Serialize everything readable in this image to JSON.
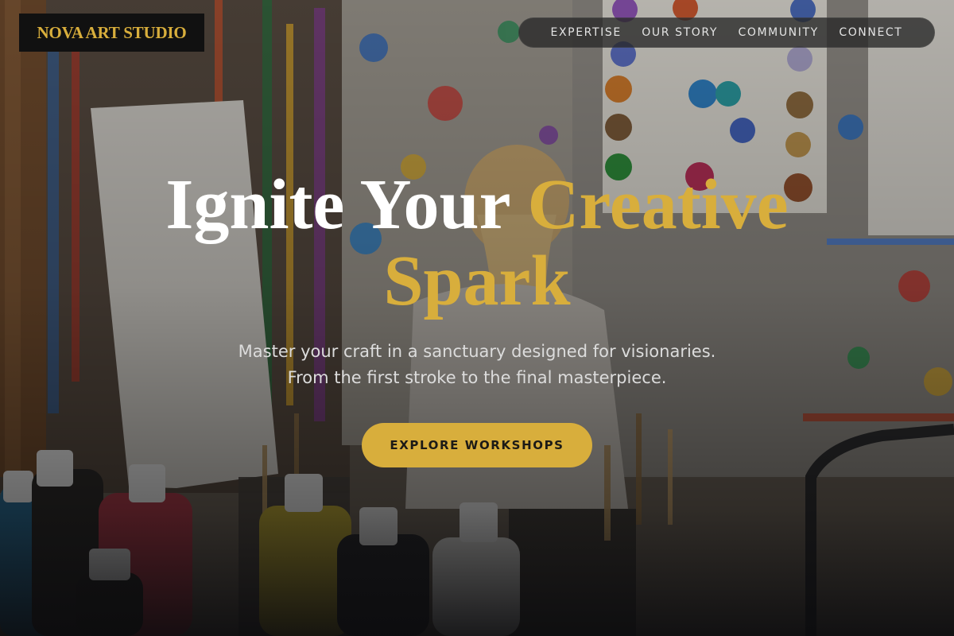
{
  "brand": {
    "logo_text": "NOVA ART STUDIO",
    "accent_color": "#d8ae3c"
  },
  "nav": {
    "items": [
      {
        "label": "EXPERTISE"
      },
      {
        "label": "OUR STORY"
      },
      {
        "label": "COMMUNITY"
      },
      {
        "label": "CONNECT"
      }
    ]
  },
  "hero": {
    "headline_white": "Ignite Your ",
    "headline_accent_1": "Creative",
    "headline_accent_2": "Spark",
    "subtitle_line1": "Master your craft in a sanctuary designed for visionaries.",
    "subtitle_line2": "From the first stroke to the final masterpiece.",
    "cta_label": "EXPLORE WORKSHOPS",
    "background_image": "child-painting-in-art-studio"
  }
}
